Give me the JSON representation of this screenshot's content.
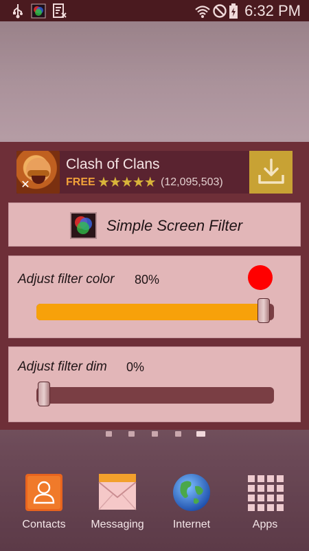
{
  "status_bar": {
    "time": "6:32 PM",
    "icons": [
      "usb-icon",
      "app-notification-icon",
      "screenshot-icon",
      "wifi-icon",
      "do-not-disturb-icon",
      "battery-charging-icon"
    ]
  },
  "ad": {
    "title": "Clash of Clans",
    "price": "FREE",
    "stars": "★★★★★",
    "rating_count": "(12,095,503)",
    "close_glyph": "✕"
  },
  "app": {
    "name": "Simple Screen Filter"
  },
  "filter_color": {
    "label": "Adjust filter color",
    "value": "80%",
    "level": 1.0,
    "dot_color": "#ff0000",
    "fill_color": "#f7a10a"
  },
  "filter_dim": {
    "label": "Adjust filter dim",
    "value": "0%",
    "level": 0.0
  },
  "home": {
    "page_count": 5,
    "active_page": 5
  },
  "dock": {
    "items": [
      {
        "label": "Contacts",
        "icon": "contacts-icon"
      },
      {
        "label": "Messaging",
        "icon": "messaging-icon"
      },
      {
        "label": "Internet",
        "icon": "globe-icon"
      },
      {
        "label": "Apps",
        "icon": "apps-grid-icon"
      }
    ]
  }
}
